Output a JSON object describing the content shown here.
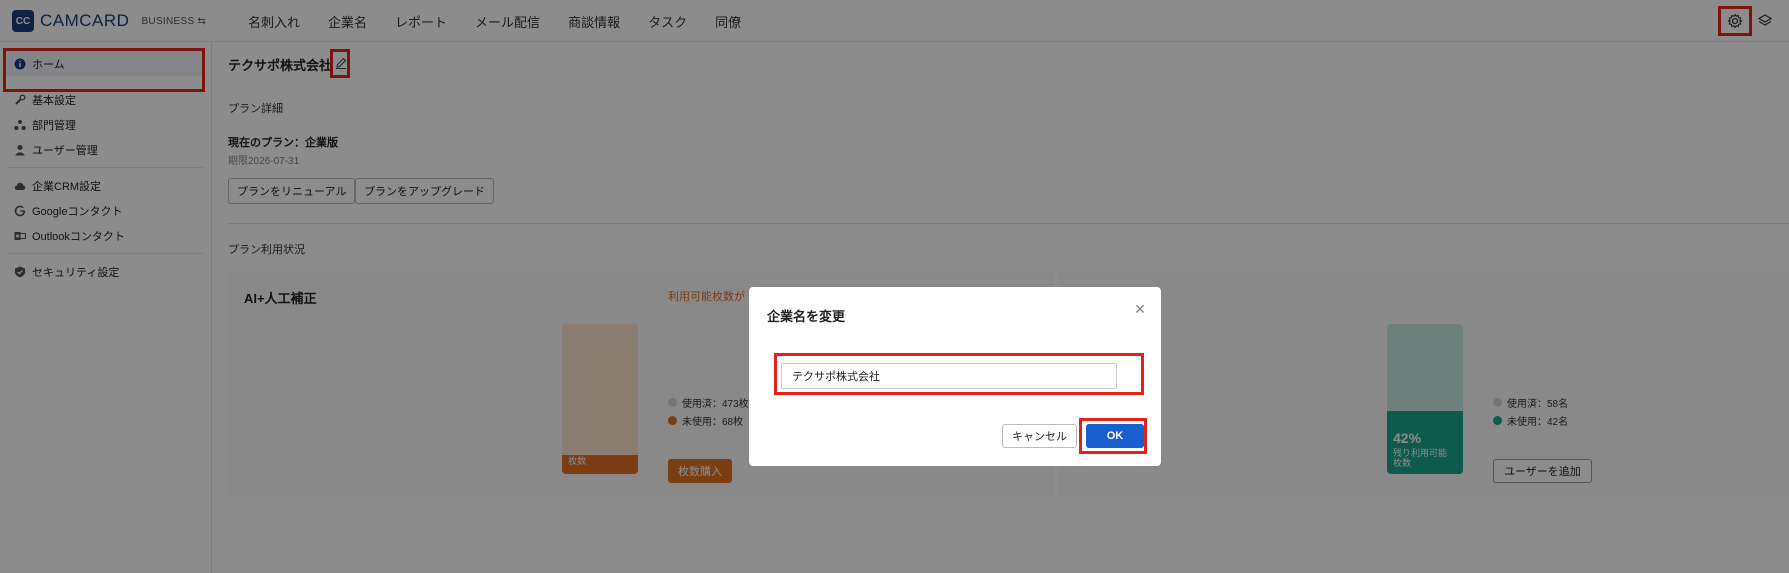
{
  "app": {
    "logo_mark": "CC",
    "name": "CAMCARD",
    "edition": "BUSINESS ⇆"
  },
  "nav": [
    {
      "label": "名刺入れ"
    },
    {
      "label": "企業名"
    },
    {
      "label": "レポート"
    },
    {
      "label": "メール配信"
    },
    {
      "label": "商談情報"
    },
    {
      "label": "タスク"
    },
    {
      "label": "同僚"
    }
  ],
  "sidebar": {
    "items": [
      {
        "label": "ホーム",
        "icon": "info-icon"
      },
      {
        "label": "基本設定",
        "icon": "wrench-icon"
      },
      {
        "label": "部門管理",
        "icon": "org-icon"
      },
      {
        "label": "ユーザー管理",
        "icon": "user-icon"
      },
      {
        "label": "企業CRM設定",
        "icon": "cloud-icon"
      },
      {
        "label": "Googleコンタクト",
        "icon": "google-icon"
      },
      {
        "label": "Outlookコンタクト",
        "icon": "outlook-icon"
      },
      {
        "label": "セキュリティ設定",
        "icon": "shield-icon"
      }
    ]
  },
  "main": {
    "company_name": "テクサポ株式会社",
    "plan_section_title": "プラン詳細",
    "plan_current": "現在のプラン：企業版",
    "plan_expire": "期限2026-07-31",
    "renew_button": "プランをリニューアル",
    "upgrade_button": "プランをアップグレード",
    "usage_section_title": "プラン利用状況"
  },
  "cards": {
    "ai": {
      "title": "AI+人工補正",
      "note": "利用可能枚数が",
      "fill_fraction": 0.13,
      "pct": "",
      "bar_label": "枚数",
      "used": "使用済：473枚",
      "unused": "未使用：68枚",
      "buy_button": "枚数購入",
      "color_main": "#e07020",
      "color_light": "#fbe3cf"
    },
    "users": {
      "title": "",
      "fill_fraction": 0.42,
      "pct": "42%",
      "bar_label": "残り利用可能\n枚数",
      "used": "使用済：58名",
      "unused": "未使用：42名",
      "add_button": "ユーザーを追加",
      "color_main": "#1aa58a",
      "color_light": "#c9ece4"
    }
  },
  "modal": {
    "title": "企業名を変更",
    "input_value": "テクサポ株式会社",
    "cancel_label": "キャンセル",
    "ok_label": "OK"
  }
}
